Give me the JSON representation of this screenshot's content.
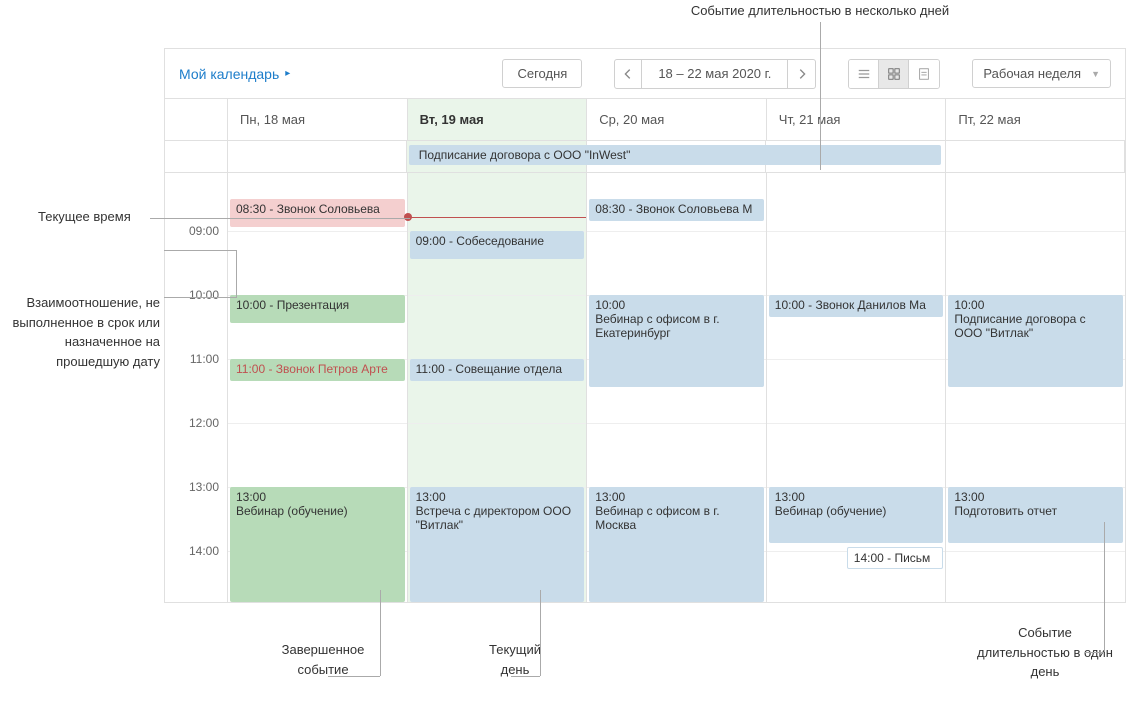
{
  "annotations": {
    "multi_day": "Событие длительностью в несколько дней",
    "now": "Текущее время",
    "overdue": "Взаимоотношение, не выполненное в срок или назначенное на прошедшую дату",
    "completed": "Завершенное событие",
    "current_day": "Текущий день",
    "one_day": "Событие длительностью в один день"
  },
  "toolbar": {
    "breadcrumb": "Мой календарь",
    "today": "Сегодня",
    "date_range": "18 – 22 мая 2020 г.",
    "view_label": "Рабочая неделя"
  },
  "days": [
    {
      "label": "Пн, 18 мая",
      "today": false
    },
    {
      "label": "Вт, 19 мая",
      "today": true
    },
    {
      "label": "Ср, 20 мая",
      "today": false
    },
    {
      "label": "Чт, 21 мая",
      "today": false
    },
    {
      "label": "Пт, 22 мая",
      "today": false
    }
  ],
  "allday_event": "Подписание договора с ООО \"InWest\"",
  "hours": [
    "09:00",
    "10:00",
    "11:00",
    "12:00",
    "13:00",
    "14:00"
  ],
  "events": {
    "mon": {
      "e1": "08:30 - Звонок Соловьева",
      "e2": "10:00 - Презентация",
      "e3": "11:00 - Звонок Петров Арте",
      "e4_time": "13:00",
      "e4_title": "Вебинар (обучение)"
    },
    "tue": {
      "e1": "09:00 - Собеседование",
      "e2": "11:00 - Совещание отдела",
      "e3_time": "13:00",
      "e3_title": "Встреча с директором ООО \"Витлак\""
    },
    "wed": {
      "e1": "08:30 - Звонок Соловьева М",
      "e2_time": "10:00",
      "e2_title": "Вебинар с офисом в г. Екатеринбург",
      "e3_time": "13:00",
      "e3_title": "Вебинар с офисом в г. Москва"
    },
    "thu": {
      "e1": "10:00 - Звонок Данилов Ма",
      "e2_time": "13:00",
      "e2_title": "Вебинар (обучение)",
      "e3": "14:00 - Письм"
    },
    "fri": {
      "e1_time": "10:00",
      "e1_title": "Подписание договора с ООО \"Витлак\"",
      "e2_time": "13:00",
      "e2_title": "Подготовить отчет"
    }
  }
}
